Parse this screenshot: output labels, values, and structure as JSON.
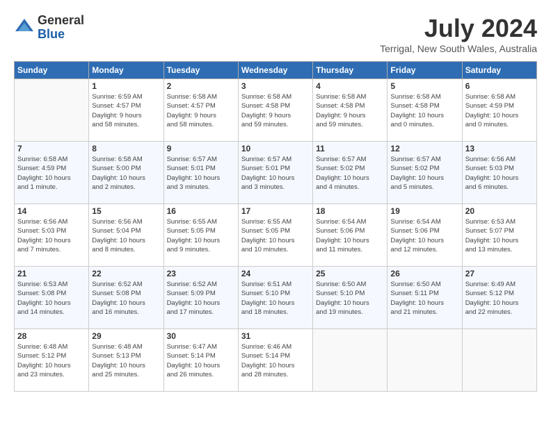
{
  "header": {
    "logo_general": "General",
    "logo_blue": "Blue",
    "month_title": "July 2024",
    "location": "Terrigal, New South Wales, Australia"
  },
  "days_of_week": [
    "Sunday",
    "Monday",
    "Tuesday",
    "Wednesday",
    "Thursday",
    "Friday",
    "Saturday"
  ],
  "weeks": [
    [
      {
        "day": "",
        "info": ""
      },
      {
        "day": "1",
        "info": "Sunrise: 6:59 AM\nSunset: 4:57 PM\nDaylight: 9 hours\nand 58 minutes."
      },
      {
        "day": "2",
        "info": "Sunrise: 6:58 AM\nSunset: 4:57 PM\nDaylight: 9 hours\nand 58 minutes."
      },
      {
        "day": "3",
        "info": "Sunrise: 6:58 AM\nSunset: 4:58 PM\nDaylight: 9 hours\nand 59 minutes."
      },
      {
        "day": "4",
        "info": "Sunrise: 6:58 AM\nSunset: 4:58 PM\nDaylight: 9 hours\nand 59 minutes."
      },
      {
        "day": "5",
        "info": "Sunrise: 6:58 AM\nSunset: 4:58 PM\nDaylight: 10 hours\nand 0 minutes."
      },
      {
        "day": "6",
        "info": "Sunrise: 6:58 AM\nSunset: 4:59 PM\nDaylight: 10 hours\nand 0 minutes."
      }
    ],
    [
      {
        "day": "7",
        "info": "Sunrise: 6:58 AM\nSunset: 4:59 PM\nDaylight: 10 hours\nand 1 minute."
      },
      {
        "day": "8",
        "info": "Sunrise: 6:58 AM\nSunset: 5:00 PM\nDaylight: 10 hours\nand 2 minutes."
      },
      {
        "day": "9",
        "info": "Sunrise: 6:57 AM\nSunset: 5:01 PM\nDaylight: 10 hours\nand 3 minutes."
      },
      {
        "day": "10",
        "info": "Sunrise: 6:57 AM\nSunset: 5:01 PM\nDaylight: 10 hours\nand 3 minutes."
      },
      {
        "day": "11",
        "info": "Sunrise: 6:57 AM\nSunset: 5:02 PM\nDaylight: 10 hours\nand 4 minutes."
      },
      {
        "day": "12",
        "info": "Sunrise: 6:57 AM\nSunset: 5:02 PM\nDaylight: 10 hours\nand 5 minutes."
      },
      {
        "day": "13",
        "info": "Sunrise: 6:56 AM\nSunset: 5:03 PM\nDaylight: 10 hours\nand 6 minutes."
      }
    ],
    [
      {
        "day": "14",
        "info": "Sunrise: 6:56 AM\nSunset: 5:03 PM\nDaylight: 10 hours\nand 7 minutes."
      },
      {
        "day": "15",
        "info": "Sunrise: 6:56 AM\nSunset: 5:04 PM\nDaylight: 10 hours\nand 8 minutes."
      },
      {
        "day": "16",
        "info": "Sunrise: 6:55 AM\nSunset: 5:05 PM\nDaylight: 10 hours\nand 9 minutes."
      },
      {
        "day": "17",
        "info": "Sunrise: 6:55 AM\nSunset: 5:05 PM\nDaylight: 10 hours\nand 10 minutes."
      },
      {
        "day": "18",
        "info": "Sunrise: 6:54 AM\nSunset: 5:06 PM\nDaylight: 10 hours\nand 11 minutes."
      },
      {
        "day": "19",
        "info": "Sunrise: 6:54 AM\nSunset: 5:06 PM\nDaylight: 10 hours\nand 12 minutes."
      },
      {
        "day": "20",
        "info": "Sunrise: 6:53 AM\nSunset: 5:07 PM\nDaylight: 10 hours\nand 13 minutes."
      }
    ],
    [
      {
        "day": "21",
        "info": "Sunrise: 6:53 AM\nSunset: 5:08 PM\nDaylight: 10 hours\nand 14 minutes."
      },
      {
        "day": "22",
        "info": "Sunrise: 6:52 AM\nSunset: 5:08 PM\nDaylight: 10 hours\nand 16 minutes."
      },
      {
        "day": "23",
        "info": "Sunrise: 6:52 AM\nSunset: 5:09 PM\nDaylight: 10 hours\nand 17 minutes."
      },
      {
        "day": "24",
        "info": "Sunrise: 6:51 AM\nSunset: 5:10 PM\nDaylight: 10 hours\nand 18 minutes."
      },
      {
        "day": "25",
        "info": "Sunrise: 6:50 AM\nSunset: 5:10 PM\nDaylight: 10 hours\nand 19 minutes."
      },
      {
        "day": "26",
        "info": "Sunrise: 6:50 AM\nSunset: 5:11 PM\nDaylight: 10 hours\nand 21 minutes."
      },
      {
        "day": "27",
        "info": "Sunrise: 6:49 AM\nSunset: 5:12 PM\nDaylight: 10 hours\nand 22 minutes."
      }
    ],
    [
      {
        "day": "28",
        "info": "Sunrise: 6:48 AM\nSunset: 5:12 PM\nDaylight: 10 hours\nand 23 minutes."
      },
      {
        "day": "29",
        "info": "Sunrise: 6:48 AM\nSunset: 5:13 PM\nDaylight: 10 hours\nand 25 minutes."
      },
      {
        "day": "30",
        "info": "Sunrise: 6:47 AM\nSunset: 5:14 PM\nDaylight: 10 hours\nand 26 minutes."
      },
      {
        "day": "31",
        "info": "Sunrise: 6:46 AM\nSunset: 5:14 PM\nDaylight: 10 hours\nand 28 minutes."
      },
      {
        "day": "",
        "info": ""
      },
      {
        "day": "",
        "info": ""
      },
      {
        "day": "",
        "info": ""
      }
    ]
  ]
}
